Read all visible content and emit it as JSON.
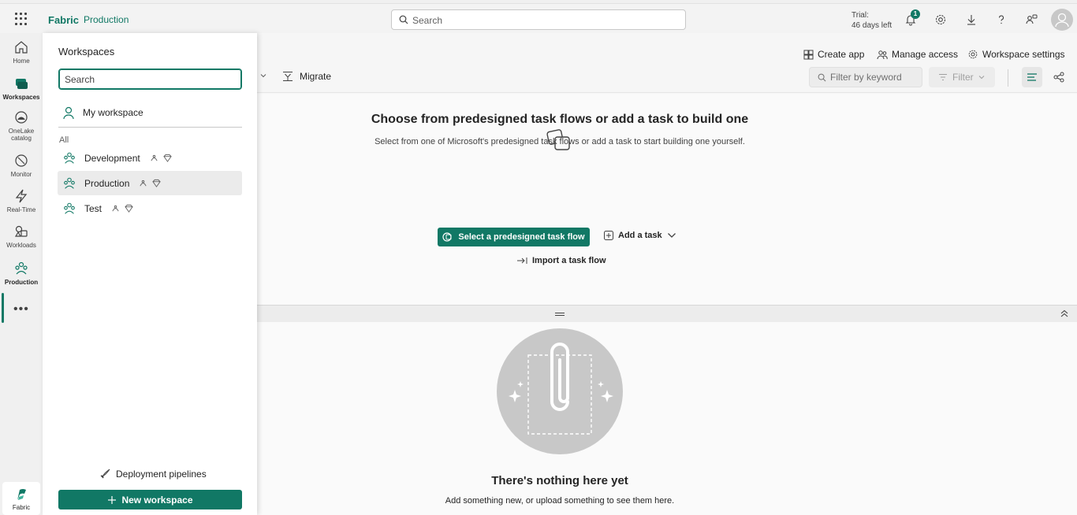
{
  "topbar": {
    "brand": "Fabric",
    "workspace": "Production",
    "search_placeholder": "Search",
    "trial_line1": "Trial:",
    "trial_line2": "46 days left",
    "notification_count": "1"
  },
  "rail": {
    "items": [
      {
        "label": "Home",
        "icon": "home-icon"
      },
      {
        "label": "Workspaces",
        "icon": "workspaces-icon"
      },
      {
        "label": "OneLake catalog",
        "icon": "onelake-icon"
      },
      {
        "label": "Monitor",
        "icon": "monitor-icon"
      },
      {
        "label": "Real-Time",
        "icon": "lightning-icon"
      },
      {
        "label": "Workloads",
        "icon": "workloads-icon"
      },
      {
        "label": "Production",
        "icon": "workspace-people-icon"
      }
    ],
    "more": "•••",
    "bottom_label": "Fabric"
  },
  "main": {
    "actions": {
      "create_app": "Create app",
      "manage_access": "Manage access",
      "workspace_settings": "Workspace settings"
    },
    "migrate": "Migrate",
    "filter_placeholder": "Filter by keyword",
    "filter_label": "Filter",
    "taskflow": {
      "title": "Choose from predesigned task flows or add a task to build one",
      "subtitle": "Select from one of Microsoft's predesigned task flows or add a task to start building one yourself.",
      "primary_button": "Select a predesigned task flow",
      "add_task": "Add a task",
      "import": "Import a task flow"
    },
    "items": {
      "empty_title": "There's nothing here yet",
      "empty_subtitle": "Add something new, or upload something to see them here."
    }
  },
  "flyout": {
    "title": "Workspaces",
    "search_placeholder": "Search",
    "my_workspace": "My workspace",
    "all_label": "All",
    "workspaces": [
      {
        "name": "Development",
        "selected": false
      },
      {
        "name": "Production",
        "selected": true
      },
      {
        "name": "Test",
        "selected": false
      }
    ],
    "deployment_pipelines": "Deployment pipelines",
    "new_workspace": "New workspace"
  },
  "colors": {
    "accent": "#117865",
    "selected_row": "#ebebeb"
  }
}
